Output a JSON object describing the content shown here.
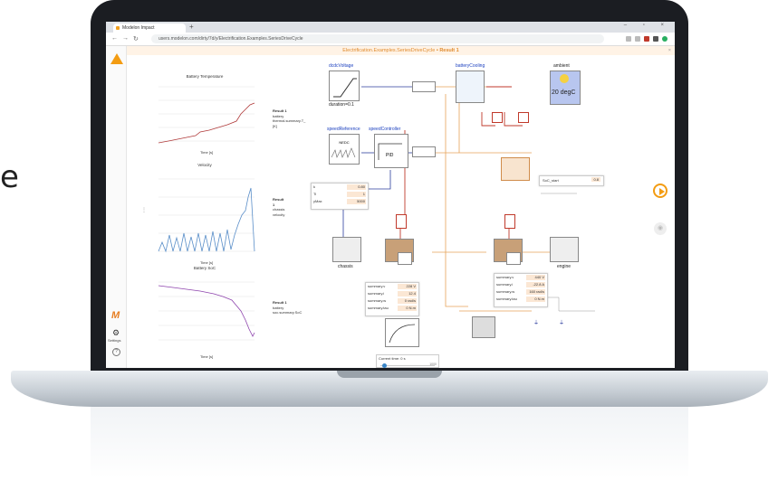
{
  "edge_text": "e",
  "browser": {
    "tab_title": "Modelon Impact",
    "new_tab": "+",
    "window_controls": "– ▫ ×",
    "url": "users.modelon.com/dirty/7d/y/Electrification.Examples.SeriesDriveCycle"
  },
  "app": {
    "title": "Electrification.Examples.SeriesDriveCycle",
    "result_label": "• Result 1",
    "settings_label": "Settings",
    "help": "?",
    "close": "×"
  },
  "charts": [
    {
      "title": "Battery Temperature",
      "legend_result": "Result 1",
      "legend_group": "battery",
      "legend_series": "thermal.summary.T_ [K]",
      "xlabel": "Time [s]",
      "color": "#b03a3a"
    },
    {
      "title": "Velocity",
      "legend_result": "Result 1",
      "legend_group": "chassis",
      "legend_series": "velocity",
      "xlabel": "Time [s]",
      "color": "#5b8fc9"
    },
    {
      "title": "Battery SoC",
      "legend_result": "Result 1",
      "legend_group": "battery",
      "legend_series": "soc.summary.SoC",
      "xlabel": "Time [s]",
      "color": "#8e44ad"
    }
  ],
  "diagram": {
    "dcdc_voltage": "dcdcVoltage",
    "duration": "duration=0.1",
    "speed_reference": "speedReference",
    "nedc": "NEDC",
    "speed_controller": "speedController",
    "pid": "PID",
    "battery_cooling": "batteryCooling",
    "ambient": "ambient",
    "ambient_value": "20 degC",
    "chassis": "chassis",
    "engine": "engine",
    "soc_start_label": "SoC_start",
    "soc_start_value": "0.8"
  },
  "panel_controller": {
    "rows": [
      {
        "k": "k",
        "v": "0.80"
      },
      {
        "k": "Ti",
        "v": "1"
      },
      {
        "k": "yMax",
        "v": "5000"
      }
    ]
  },
  "panel_motor": {
    "rows": [
      {
        "k": "summary.v",
        "v": "228 V"
      },
      {
        "k": "summary.i",
        "v": "12.4"
      },
      {
        "k": "summary.w",
        "v": "0 rad/s"
      },
      {
        "k": "summary.tau",
        "v": "0 N.m"
      }
    ]
  },
  "panel_generator": {
    "rows": [
      {
        "k": "summary.v",
        "v": "440 V"
      },
      {
        "k": "summary.i",
        "v": "-22.8 A"
      },
      {
        "k": "summary.w",
        "v": "160 rad/s"
      },
      {
        "k": "summary.tau",
        "v": "0 N.m"
      }
    ]
  },
  "current_time": {
    "label": "Current time: 0 s",
    "end": "1000"
  }
}
